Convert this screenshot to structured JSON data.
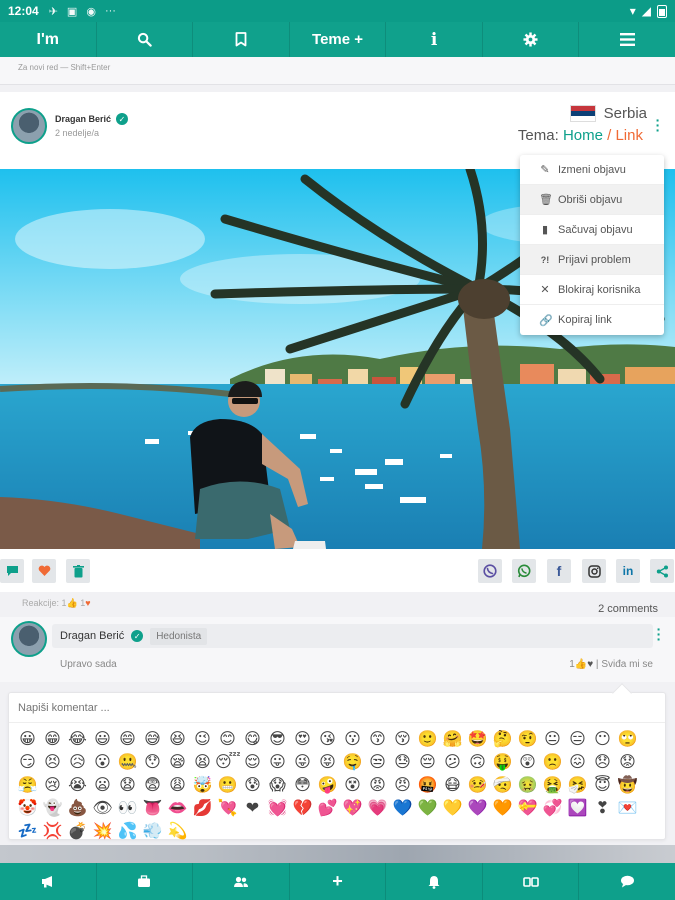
{
  "status_bar": {
    "time": "12:04",
    "icons": [
      "airplane-icon",
      "image-icon",
      "chrome-icon",
      "more-icon"
    ],
    "more": "···"
  },
  "top_nav": {
    "logo": "I'm",
    "items": [
      {
        "name": "search-icon",
        "glyph": ""
      },
      {
        "name": "bookmark-icon",
        "glyph": ""
      },
      {
        "name": "teme-button",
        "label": "Teme +"
      },
      {
        "name": "info-icon",
        "glyph": "i"
      },
      {
        "name": "settings-icon",
        "glyph": ""
      },
      {
        "name": "menu-icon",
        "glyph": "≡"
      }
    ]
  },
  "hint": {
    "text": "Za novi red — Shift+Enter"
  },
  "post": {
    "author": "Dragan Berić",
    "time": "2 nedelje/a",
    "country": "Serbia",
    "flag_colors": [
      "#c6363c",
      "#0c4076",
      "#ffffff"
    ],
    "tema_label": "Tema:",
    "tema_home": "Home",
    "tema_sep": " / ",
    "tema_link": "Link",
    "actions": [
      "comment-icon",
      "heart-icon",
      "delete-icon"
    ],
    "share": [
      "viber-icon",
      "whatsapp-icon",
      "facebook-icon",
      "instagram-icon",
      "linkedin-icon",
      "share-icon"
    ]
  },
  "dropdown": {
    "items": [
      {
        "label": "Izmeni objavu",
        "icon": "pencil-icon",
        "glyph": "✎"
      },
      {
        "label": "Obriši objavu",
        "icon": "trash-icon",
        "glyph": "🗑"
      },
      {
        "label": "Sačuvaj objavu",
        "icon": "bookmark-icon",
        "glyph": "▮"
      },
      {
        "label": "Prijavi problem",
        "icon": "report-icon",
        "glyph": "?!"
      },
      {
        "label": "Blokiraj korisnika",
        "icon": "block-icon",
        "glyph": "✕"
      },
      {
        "label": "Kopiraj link",
        "icon": "link-icon",
        "glyph": "🔗"
      }
    ]
  },
  "reactions": {
    "label": "Reakcije:",
    "likes": "1",
    "hearts": "1"
  },
  "comments_count": "2 comments",
  "comment": {
    "author": "Dragan Berić",
    "role": "Hedonista",
    "time": "Upravo sada",
    "likes": "1",
    "like_label": "Sviđa mi se"
  },
  "comment_input": {
    "placeholder": "Napiši komentar ..."
  },
  "emoji": [
    "😀",
    "😁",
    "😂",
    "😃",
    "😄",
    "😅",
    "😆",
    "😉",
    "😊",
    "😋",
    "😎",
    "😍",
    "😘",
    "😗",
    "😙",
    "😚",
    "🙂",
    "🤗",
    "🤩",
    "🤔",
    "🤨",
    "😐",
    "😑",
    "😶",
    "🙄",
    "😏",
    "😣",
    "😥",
    "😮",
    "🤐",
    "😯",
    "😪",
    "😫",
    "😴",
    "😌",
    "😛",
    "😜",
    "😝",
    "🤤",
    "😒",
    "😓",
    "😔",
    "😕",
    "🙃",
    "🤑",
    "😲",
    "🙁",
    "😖",
    "😞",
    "😟",
    "😤",
    "😢",
    "😭",
    "😦",
    "😧",
    "😨",
    "😩",
    "🤯",
    "😬",
    "😰",
    "😱",
    "😳",
    "🤪",
    "😵",
    "😡",
    "😠",
    "🤬",
    "😷",
    "🤒",
    "🤕",
    "🤢",
    "🤮",
    "🤧",
    "😇",
    "🤠",
    "🤡",
    "👻",
    "💩",
    "👁",
    "👀",
    "👅",
    "👄",
    "💋",
    "💘",
    "❤",
    "💓",
    "💔",
    "💕",
    "💖",
    "💗",
    "💙",
    "💚",
    "💛",
    "💜",
    "🧡",
    "💝",
    "💞",
    "💟",
    "❣",
    "💌",
    "💤",
    "💢",
    "💣",
    "💥",
    "💦",
    "💨",
    "💫"
  ],
  "bottom_nav": [
    "megaphone-icon",
    "briefcase-icon",
    "users-icon",
    "plus-icon",
    "bell-icon",
    "cards-icon",
    "chat-icon"
  ],
  "colors": {
    "accent": "#0ea08b",
    "accent_alt": "#f06a35"
  }
}
